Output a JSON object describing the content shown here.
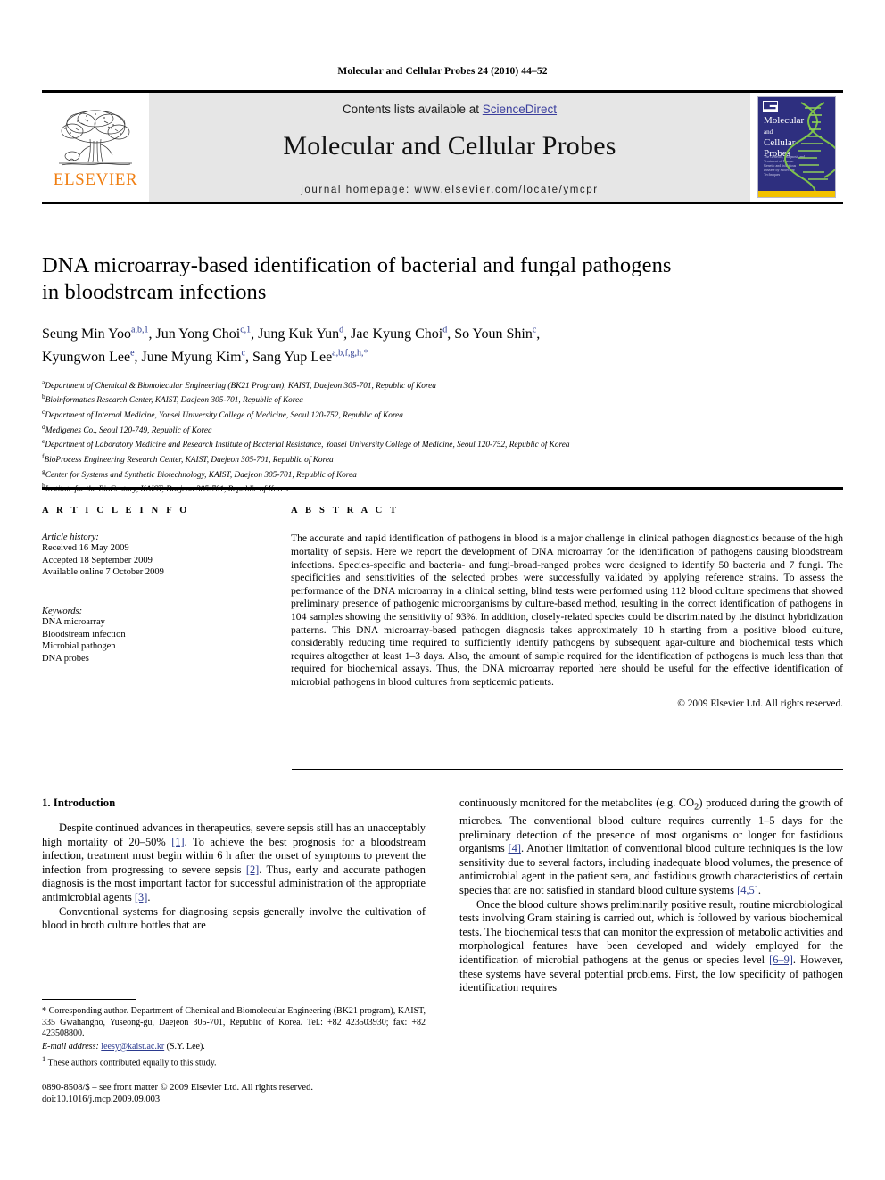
{
  "running_head": "Molecular and Cellular Probes 24 (2010) 44–52",
  "masthead": {
    "contents_prefix": "Contents lists available at ",
    "sciencedirect": "ScienceDirect",
    "journal_name": "Molecular and Cellular Probes",
    "homepage": "journal homepage: www.elsevier.com/locate/ymcpr",
    "publisher_logo_text": "ELSEVIER",
    "cover": {
      "title_line1": "Molecular",
      "title_line2": "and",
      "title_line3": "Cellular",
      "title_line4": "Probes",
      "subtitle": "The Genetics, Diagnosis and Treatment of Human Genetic and Infectious Disease by Molecular Techniques"
    },
    "accent_orange": "#F07F13",
    "link_blue": "#3b3f9e",
    "band_gray": "#e6e6e6",
    "cover_navy": "#2e2f7f"
  },
  "article": {
    "title_line1": "DNA microarray-based identification of bacterial and fungal pathogens",
    "title_line2": "in bloodstream infections",
    "authors_line1_parts": [
      {
        "name": "Seung Min Yoo",
        "sup": "a,b,1",
        "sep": ", "
      },
      {
        "name": "Jun Yong Choi",
        "sup": "c,1",
        "sep": ", "
      },
      {
        "name": "Jung Kuk Yun",
        "sup": "d",
        "sep": ", "
      },
      {
        "name": "Jae Kyung Choi",
        "sup": "d",
        "sep": ", "
      },
      {
        "name": "So Youn Shin",
        "sup": "c",
        "sep": ","
      }
    ],
    "authors_line2_parts": [
      {
        "name": "Kyungwon Lee",
        "sup": "e",
        "sep": ", "
      },
      {
        "name": "June Myung Kim",
        "sup": "c",
        "sep": ", "
      },
      {
        "name": "Sang Yup Lee",
        "sup": "a,b,f,g,h,*",
        "sep": ""
      }
    ],
    "affiliations": [
      {
        "mark": "a",
        "text": "Department of Chemical & Biomolecular Engineering (BK21 Program), KAIST, Daejeon 305-701, Republic of Korea"
      },
      {
        "mark": "b",
        "text": "Bioinformatics Research Center, KAIST, Daejeon 305-701, Republic of Korea"
      },
      {
        "mark": "c",
        "text": "Department of Internal Medicine, Yonsei University College of Medicine, Seoul 120-752, Republic of Korea"
      },
      {
        "mark": "d",
        "text": "Medigenes Co., Seoul 120-749, Republic of Korea"
      },
      {
        "mark": "e",
        "text": "Department of Laboratory Medicine and Research Institute of Bacterial Resistance, Yonsei University College of Medicine, Seoul 120-752, Republic of Korea"
      },
      {
        "mark": "f",
        "text": "BioProcess Engineering Research Center, KAIST, Daejeon 305-701, Republic of Korea"
      },
      {
        "mark": "g",
        "text": "Center for Systems and Synthetic Biotechnology, KAIST, Daejeon 305-701, Republic of Korea"
      },
      {
        "mark": "h",
        "text": "Institute for the BioCentury, KAIST, Daejeon 305-701, Republic of Korea"
      }
    ]
  },
  "article_info": {
    "heading": "A R T I C L E    I N F O",
    "history_label": "Article history:",
    "history": [
      "Received 16 May 2009",
      "Accepted 18 September 2009",
      "Available online 7 October 2009"
    ],
    "keywords_label": "Keywords:",
    "keywords": [
      "DNA microarray",
      "Bloodstream infection",
      "Microbial pathogen",
      "DNA probes"
    ]
  },
  "abstract": {
    "heading": "A B S T R A C T",
    "text": "The accurate and rapid identification of pathogens in blood is a major challenge in clinical pathogen diagnostics because of the high mortality of sepsis. Here we report the development of DNA microarray for the identification of pathogens causing bloodstream infections. Species-specific and bacteria- and fungi-broad-ranged probes were designed to identify 50 bacteria and 7 fungi. The specificities and sensitivities of the selected probes were successfully validated by applying reference strains. To assess the performance of the DNA microarray in a clinical setting, blind tests were performed using 112 blood culture specimens that showed preliminary presence of pathogenic microorganisms by culture-based method, resulting in the correct identification of pathogens in 104 samples showing the sensitivity of 93%. In addition, closely-related species could be discriminated by the distinct hybridization patterns. This DNA microarray-based pathogen diagnosis takes approximately 10 h starting from a positive blood culture, considerably reducing time required to sufficiently identify pathogens by subsequent agar-culture and biochemical tests which requires altogether at least 1–3 days. Also, the amount of sample required for the identification of pathogens is much less than that required for biochemical assays. Thus, the DNA microarray reported here should be useful for the effective identification of microbial pathogens in blood cultures from septicemic patients.",
    "copyright": "© 2009 Elsevier Ltd. All rights reserved."
  },
  "introduction": {
    "heading": "1. Introduction",
    "left_paragraphs": [
      {
        "segments": [
          {
            "t": "Despite continued advances in therapeutics, severe sepsis still has an unacceptably high mortality of 20–50% "
          },
          {
            "t": "[1]",
            "ref": true
          },
          {
            "t": ". To achieve the best prognosis for a bloodstream infection, treatment must begin within 6 h after the onset of symptoms to prevent the infection from progressing to severe sepsis "
          },
          {
            "t": "[2]",
            "ref": true
          },
          {
            "t": ". Thus, early and accurate pathogen diagnosis is the most important factor for successful administration of the appropriate antimicrobial agents "
          },
          {
            "t": "[3]",
            "ref": true
          },
          {
            "t": "."
          }
        ]
      },
      {
        "segments": [
          {
            "t": "Conventional systems for diagnosing sepsis generally involve the cultivation of blood in broth culture bottles that are"
          }
        ]
      }
    ],
    "right_paragraphs": [
      {
        "segments": [
          {
            "t": "continuously monitored for the metabolites (e.g. CO"
          },
          {
            "t": "2",
            "sub": true
          },
          {
            "t": ") produced during the growth of microbes. The conventional blood culture requires currently 1–5 days for the preliminary detection of the presence of most organisms or longer for fastidious organisms "
          },
          {
            "t": "[4]",
            "ref": true
          },
          {
            "t": ". Another limitation of conventional blood culture techniques is the low sensitivity due to several factors, including inadequate blood volumes, the presence of antimicrobial agent in the patient sera, and fastidious growth characteristics of certain species that are not satisfied in standard blood culture systems "
          },
          {
            "t": "[4,5]",
            "ref": true
          },
          {
            "t": "."
          }
        ],
        "noindent": true
      },
      {
        "segments": [
          {
            "t": "Once the blood culture shows preliminarily positive result, routine microbiological tests involving Gram staining is carried out, which is followed by various biochemical tests. The biochemical tests that can monitor the expression of metabolic activities and morphological features have been developed and widely employed for the identification of microbial pathogens at the genus or species level "
          },
          {
            "t": "[6–9]",
            "ref": true
          },
          {
            "t": ". However, these systems have several potential problems. First, the low specificity of pathogen identification requires"
          }
        ]
      }
    ]
  },
  "footnotes": {
    "corresponding": "* Corresponding author. Department of Chemical and Biomolecular Engineering (BK21 program), KAIST, 335 Gwahangno, Yuseong-gu, Daejeon 305-701, Republic of Korea. Tel.: +82 423503930; fax: +82 423508800.",
    "email_label": "E-mail address:",
    "email": "leesy@kaist.ac.kr",
    "email_suffix": "(S.Y. Lee).",
    "equal_contrib_mark": "1",
    "equal_contrib": "These authors contributed equally to this study."
  },
  "footer": {
    "issn_line": "0890-8508/$ – see front matter © 2009 Elsevier Ltd. All rights reserved.",
    "doi_line": "doi:10.1016/j.mcp.2009.09.003"
  }
}
